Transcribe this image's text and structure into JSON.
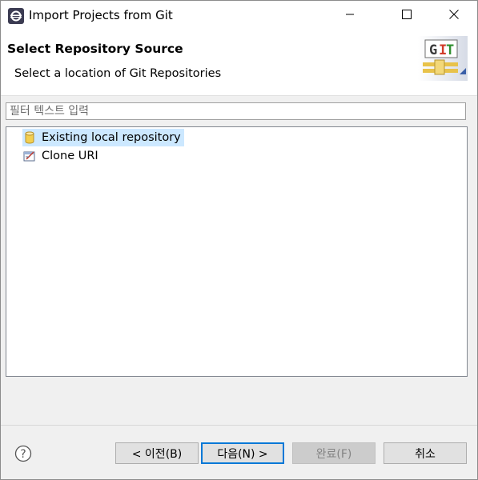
{
  "window": {
    "title": "Import Projects from Git"
  },
  "controls": {
    "minimize_icon": "minimize-icon",
    "maximize_icon": "maximize-icon",
    "close_icon": "close-icon"
  },
  "banner": {
    "title": "Select Repository Source",
    "description": "Select a location of Git Repositories",
    "logo_text": "GIT"
  },
  "filter": {
    "placeholder": "필터 텍스트 입력",
    "value": ""
  },
  "tree": {
    "items": [
      {
        "label": "Existing local repository",
        "icon": "repository-icon",
        "selected": true
      },
      {
        "label": "Clone URI",
        "icon": "clone-uri-icon",
        "selected": false
      }
    ]
  },
  "footer": {
    "help_icon": "help-icon",
    "back_label": "< 이전(B)",
    "next_label": "다음(N) >",
    "finish_label": "완료(F)",
    "cancel_label": "취소"
  },
  "colors": {
    "selection": "#cce8ff",
    "default_button_border": "#0078d7",
    "disabled_button_bg": "#cccccc"
  }
}
